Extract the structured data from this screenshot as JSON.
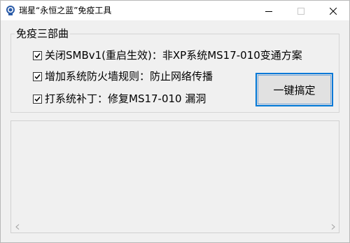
{
  "window": {
    "title": "瑞星“永恒之蓝”免疫工具",
    "app_icon": "rising-logo-icon",
    "controls": [
      "minimize-icon",
      "maximize-icon",
      "close-icon"
    ]
  },
  "group": {
    "title": "免疫三部曲",
    "options": [
      {
        "label": "关闭SMBv1(重启生效)：非XP系统MS17-010变通方案",
        "checked": true
      },
      {
        "label": "增加系统防火墙规则：防止网络传播",
        "checked": true
      },
      {
        "label": "打系统补丁：修复MS17-010 漏洞",
        "checked": true
      }
    ]
  },
  "action": {
    "button_label": "一键搞定"
  },
  "log": {
    "text": ""
  },
  "colors": {
    "window_bg": "#f0f0f0",
    "titlebar_bg": "#ffffff",
    "button_focus_border": "#0078d7",
    "button_bg": "#e1e1e1"
  }
}
